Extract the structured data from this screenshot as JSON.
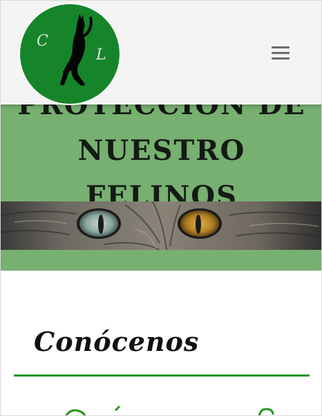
{
  "header": {
    "logo_initials": [
      "C",
      "L"
    ],
    "menu_icon": "hamburger-menu-icon"
  },
  "hero": {
    "title_line1": "PROTECCIÓN DE",
    "title_line2": "NUESTRO FELINOS",
    "background": "#77b071",
    "image": "cat-eyes-photo"
  },
  "main": {
    "section_title": "Conócenos"
  },
  "colors": {
    "logo_green": "#16852a",
    "divider_green": "#27951f",
    "header_bg": "#f4f4f4"
  }
}
